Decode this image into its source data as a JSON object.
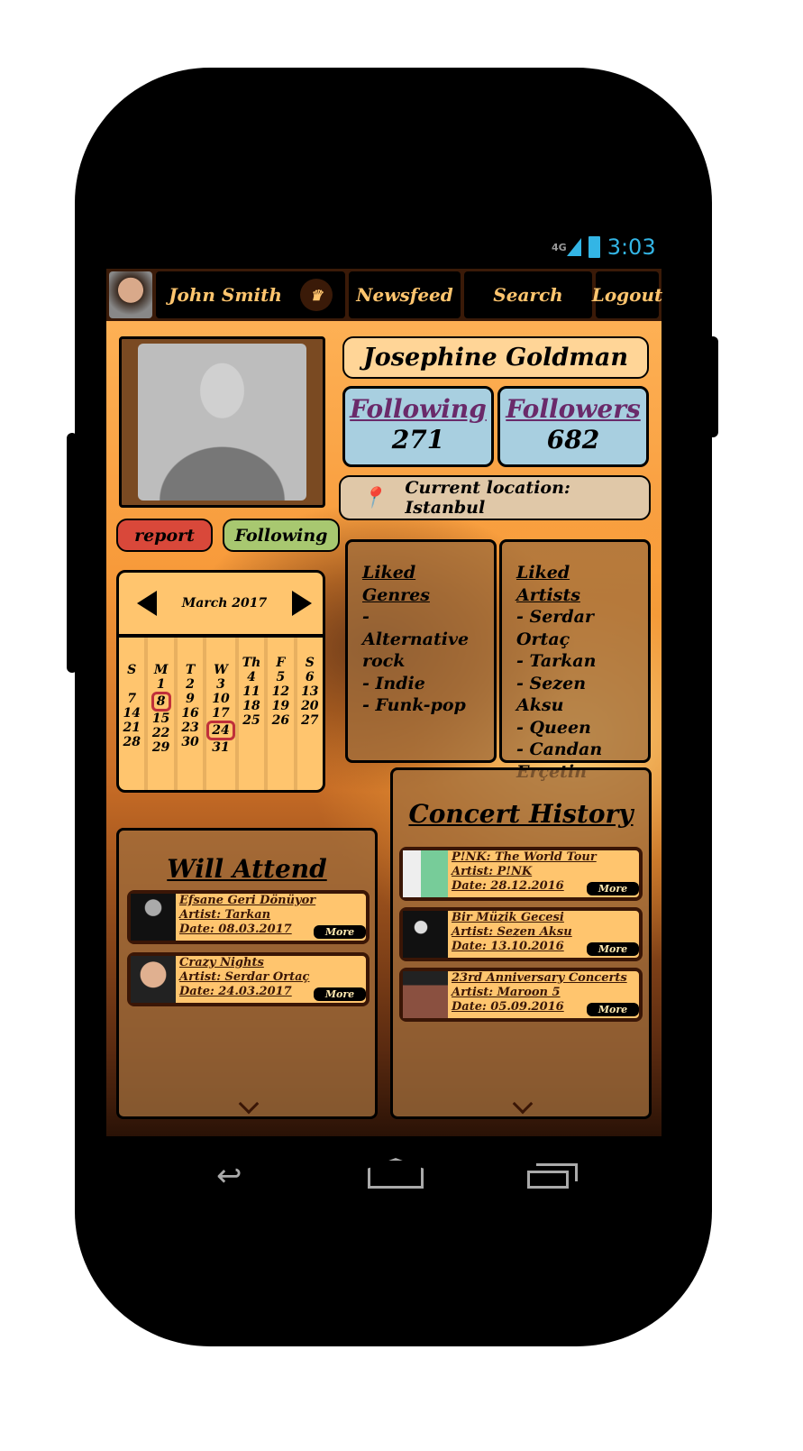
{
  "status_bar": {
    "network": "4G",
    "time": "3:03"
  },
  "nav": {
    "user_name": "John Smith",
    "newsfeed": "Newsfeed",
    "search": "Search",
    "logout": "Logout"
  },
  "profile": {
    "name": "Josephine Goldman",
    "following_label": "Following",
    "following_count": "271",
    "followers_label": "Followers",
    "followers_count": "682",
    "location": "Current location: Istanbul",
    "report_label": "report",
    "follow_state_label": "Following"
  },
  "calendar": {
    "month": "March 2017",
    "columns": [
      {
        "day": "S",
        "dates": [
          "",
          "7",
          "14",
          "21",
          "28"
        ]
      },
      {
        "day": "M",
        "dates": [
          "1",
          "8",
          "15",
          "22",
          "29"
        ]
      },
      {
        "day": "T",
        "dates": [
          "2",
          "9",
          "16",
          "23",
          "30"
        ]
      },
      {
        "day": "W",
        "dates": [
          "3",
          "10",
          "17",
          "24",
          "31"
        ]
      },
      {
        "day": "Th",
        "dates": [
          "4",
          "11",
          "18",
          "25"
        ]
      },
      {
        "day": "F",
        "dates": [
          "5",
          "12",
          "19",
          "26"
        ]
      },
      {
        "day": "S",
        "dates": [
          "6",
          "13",
          "20",
          "27"
        ]
      }
    ],
    "highlighted": [
      "8",
      "24"
    ]
  },
  "liked_genres": {
    "title": "Liked Genres",
    "items": [
      "- Alternative rock",
      "- Indie",
      "- Funk-pop"
    ]
  },
  "liked_artists": {
    "title": "Liked Artists",
    "items": [
      "- Serdar Ortaç",
      "- Tarkan",
      "- Sezen Aksu",
      "- Queen",
      "- Candan Erçetin"
    ]
  },
  "will_attend": {
    "title": "Will Attend",
    "items": [
      {
        "name": "Efsane Geri Dönüyor",
        "artist": "Artist: Tarkan",
        "date": "Date: 08.03.2017",
        "more": "More"
      },
      {
        "name": "Crazy Nights",
        "artist": "Artist: Serdar Ortaç",
        "date": "Date: 24.03.2017",
        "more": "More"
      }
    ]
  },
  "concert_history": {
    "title": "Concert History",
    "items": [
      {
        "name": "P!NK: The World Tour",
        "artist": "Artist: P!NK",
        "date": "Date: 28.12.2016",
        "more": "More"
      },
      {
        "name": "Bir Müzik Gecesi",
        "artist": "Artist: Sezen Aksu",
        "date": "Date: 13.10.2016",
        "more": "More"
      },
      {
        "name": "23rd Anniversary Concerts",
        "artist": "Artist: Maroon 5",
        "date": "Date: 05.09.2016",
        "more": "More"
      }
    ]
  },
  "colors": {
    "accent": "#ffc56e",
    "nav_bg": "#000000",
    "stat_box": "#a8cfe0",
    "report": "#d9483a",
    "following": "#a8c870",
    "status_blue": "#33b5e5"
  }
}
